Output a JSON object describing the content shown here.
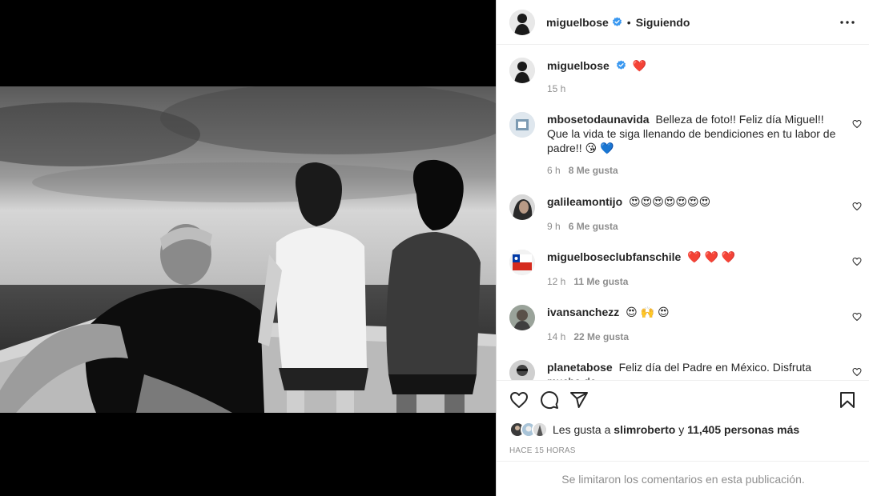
{
  "post": {
    "author": "miguelbose",
    "follow_status": "Siguiendo",
    "separator": "•"
  },
  "caption": {
    "username": "miguelbose",
    "emoji": "❤️",
    "time": "15 h"
  },
  "comments": [
    {
      "username": "mbosetodaunavida",
      "text": "Belleza de foto!! Feliz día Miguel!! Que la vida te siga llenando de bendiciones en tu labor de padre!! 😘 💙",
      "time": "6 h",
      "likes": "8 Me gusta"
    },
    {
      "username": "galileamontijo",
      "text": "😍😍😍😍😍😍😍",
      "time": "9 h",
      "likes": "6 Me gusta"
    },
    {
      "username": "miguelboseclubfanschile",
      "text": "❤️ ❤️ ❤️",
      "time": "12 h",
      "likes": "11 Me gusta"
    },
    {
      "username": "ivansanchezz",
      "text": "😍 🙌 😍",
      "time": "14 h",
      "likes": "22 Me gusta"
    },
    {
      "username": "planetabose",
      "text": "Feliz día del Padre en México. Disfruta mucho de",
      "time": "",
      "likes": ""
    }
  ],
  "likes_line": {
    "prefix": "Les gusta a",
    "user": "slimroberto",
    "connector": "y",
    "count": "11,405 personas más"
  },
  "timestamp": "HACE 15 HORAS",
  "comments_limited": "Se limitaron los comentarios en esta publicación.",
  "icons": {
    "verified": "verified-badge-icon",
    "more": "more-options-icon",
    "like": "heart-icon",
    "comment": "comment-icon",
    "share": "send-icon",
    "save": "bookmark-icon"
  },
  "colors": {
    "verified_blue": "#3897f0",
    "text": "#262626",
    "secondary": "#8e8e8e",
    "border": "#dbdbdb"
  }
}
